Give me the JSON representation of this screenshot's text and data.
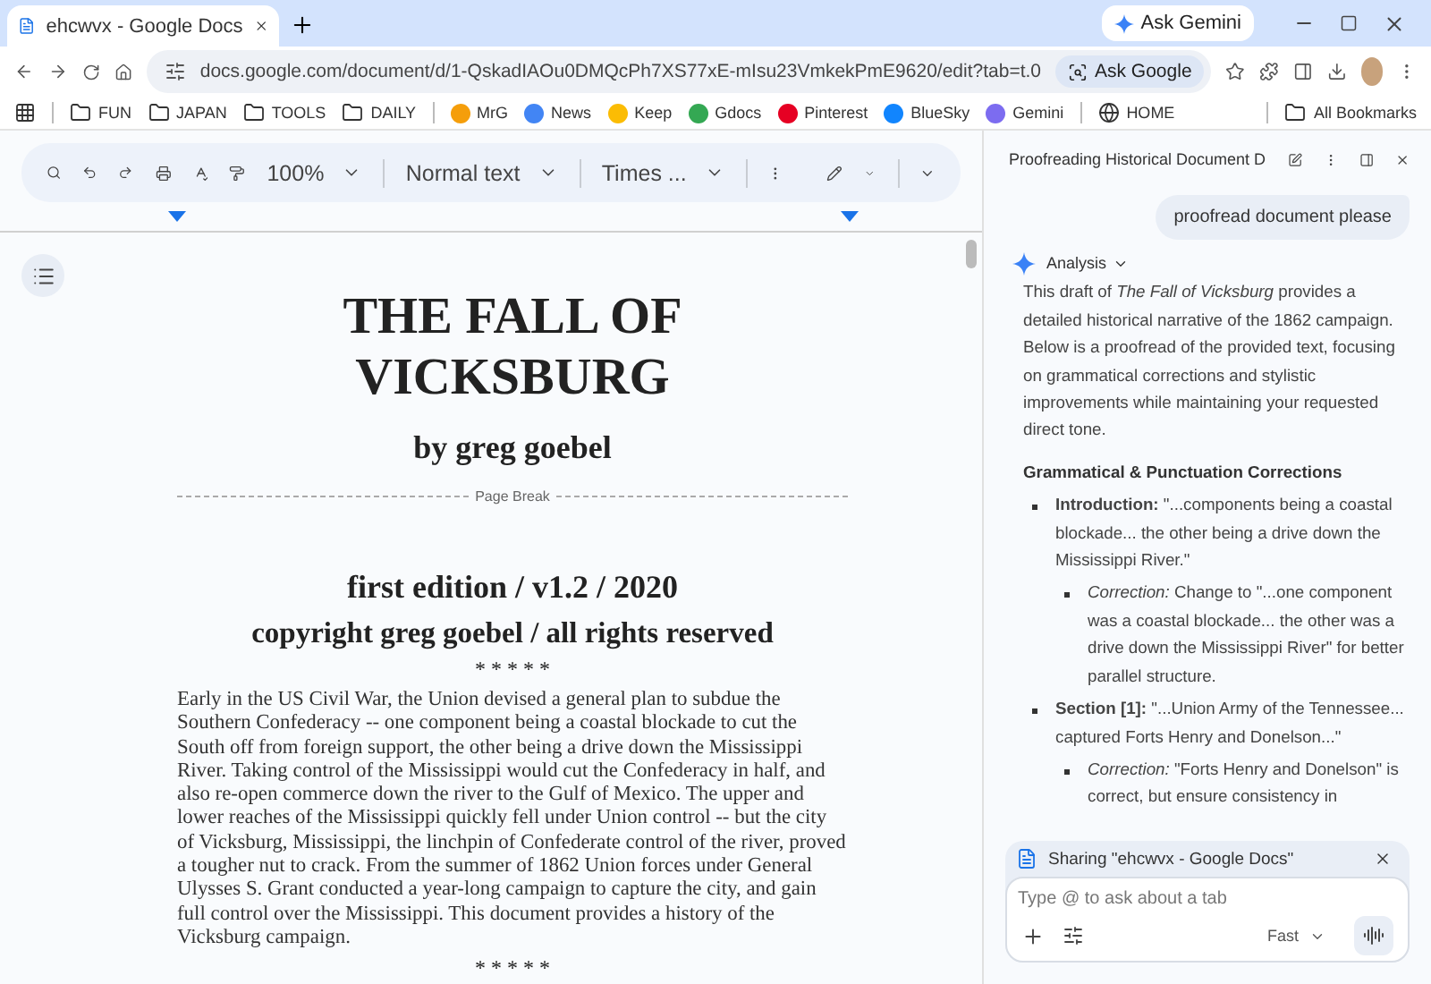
{
  "browser": {
    "tab_title": "ehcwvx - Google Docs",
    "ask_gemini": "Ask Gemini",
    "url": "docs.google.com/document/d/1-QskadIAOu0DMQcPh7XS77xE-mIsu23VmkekPmE9620/edit?tab=t.0",
    "ask_google": "Ask Google",
    "bookmarks": [
      {
        "kind": "folder",
        "label": "FUN"
      },
      {
        "kind": "folder",
        "label": "JAPAN"
      },
      {
        "kind": "folder",
        "label": "TOOLS"
      },
      {
        "kind": "folder",
        "label": "DAILY"
      },
      {
        "kind": "site",
        "label": "MrG",
        "color": "#f59e0b"
      },
      {
        "kind": "site",
        "label": "News",
        "color": "#4285f4"
      },
      {
        "kind": "site",
        "label": "Keep",
        "color": "#fbbc04"
      },
      {
        "kind": "site",
        "label": "Gdocs",
        "color": "#34a853"
      },
      {
        "kind": "site",
        "label": "Pinterest",
        "color": "#e60023"
      },
      {
        "kind": "site",
        "label": "BlueSky",
        "color": "#1185fe"
      },
      {
        "kind": "site",
        "label": "Gemini",
        "color": "#7c6cf0"
      },
      {
        "kind": "globe",
        "label": "HOME"
      }
    ],
    "all_bookmarks": "All Bookmarks"
  },
  "docs_toolbar": {
    "zoom": "100%",
    "style": "Normal text",
    "font": "Times ..."
  },
  "document": {
    "title": "THE FALL OF VICKSBURG",
    "byline": "by greg goebel",
    "page_break": "Page Break",
    "edition": "first edition / v1.2 / 2020",
    "copyright": "copyright greg goebel / all rights reserved",
    "divider_top": "* * * * *",
    "paragraph": "Early in the US Civil War, the Union devised a general plan to subdue the Southern Confederacy -- one component being a coastal blockade to cut the South off from foreign support, the other being a drive down the Mississippi River. Taking control of the Mississippi would cut the Confederacy in half, and also re-open commerce down the river to the Gulf of Mexico. The upper and lower reaches of the Mississippi quickly fell under Union control -- but the city of Vicksburg, Mississippi, the linchpin of Confederate control of the river, proved a tougher nut to crack. From the summer of 1862 Union forces under General Ulysses S. Grant conducted a year-long campaign to capture the city, and gain full control over the Mississippi. This document provides a history of the Vicksburg campaign.",
    "divider_bottom": "* * * * *"
  },
  "gemini_panel": {
    "title": "Proofreading Historical Document D",
    "user_message": "proofread document please",
    "response_label": "Analysis",
    "intro": "This draft of *The Fall of Vicksburg* provides a detailed historical narrative of the 1862 campaign. Below is a proofread of the provided text, focusing on grammatical corrections and stylistic improvements while maintaining your requested direct tone.",
    "heading": "Grammatical & Punctuation Corrections",
    "items": [
      {
        "text": "**Introduction:** \"...components being a coastal blockade... the other being a drive down the Mississippi River.\"",
        "children": [
          {
            "text": "*Correction:* Change to \"...one component was a coastal blockade... the other was a drive down the Mississippi River\" for better parallel structure."
          }
        ]
      },
      {
        "text": "**Section [1]:** \"...Union Army of the Tennessee... captured Forts Henry and Donelson...\"",
        "children": [
          {
            "text": "*Correction:* \"Forts Henry and Donelson\" is correct, but ensure consistency in"
          }
        ]
      }
    ],
    "sharing": "Sharing \"ehcwvx - Google Docs\"",
    "input_placeholder": "Type @ to ask about a tab",
    "mode": "Fast"
  }
}
